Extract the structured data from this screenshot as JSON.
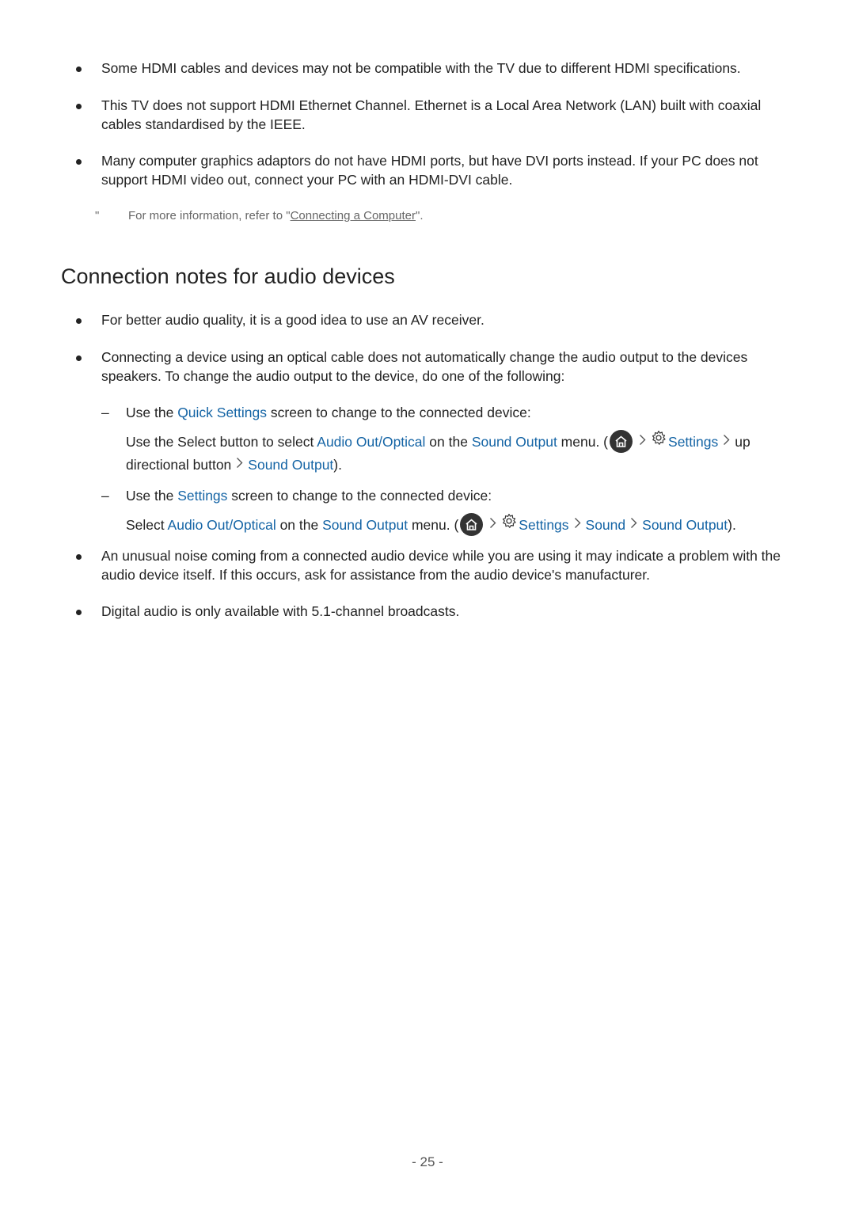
{
  "bullets_top": [
    {
      "text": "Some HDMI cables and devices may not be compatible with the TV due to different HDMI specifications."
    },
    {
      "text": "This TV does not support HDMI Ethernet Channel. Ethernet is a Local Area Network (LAN) built with coaxial cables standardised by the IEEE."
    },
    {
      "text": "Many computer graphics adaptors do not have HDMI ports, but have DVI ports instead. If your PC does not support HDMI video out, connect your PC with an HDMI-DVI cable."
    }
  ],
  "note": {
    "mark": "\"",
    "prefix": "For more information, refer to \"",
    "link": "Connecting a Computer",
    "suffix": "\"."
  },
  "section": {
    "title": "Connection notes for audio devices",
    "bullet1": "For better audio quality, it is a good idea to use an AV receiver.",
    "bullet2": "Connecting a device using an optical cable does not automatically change the audio output to the devices speakers. To change the audio output to the device, do one of the following:",
    "sub1": {
      "dash": "–",
      "pre": "Use the ",
      "link": "Quick Settings",
      "post": " screen to change to the connected device:",
      "para": {
        "t1": "Use the Select button to select ",
        "l1": "Audio Out/Optical",
        "t2": " on the ",
        "l2": "Sound Output",
        "t3": " menu. (",
        "settings": "Settings",
        "t4": "up",
        "t5": "directional button",
        "l3": "Sound Output",
        "t6": ")."
      }
    },
    "sub2": {
      "dash": "–",
      "pre": "Use the ",
      "link": "Settings",
      "post": " screen to change to the connected device:",
      "para": {
        "t1": "Select ",
        "l1": "Audio Out/Optical",
        "t2": " on the ",
        "l2": "Sound Output",
        "t3": " menu. (",
        "settings": "Settings",
        "l3": "Sound",
        "l4": "Sound Output",
        "t4": ")."
      }
    },
    "bullet3": "An unusual noise coming from a connected audio device while you are using it may indicate a problem with the audio device itself. If this occurs, ask for assistance from the audio device's manufacturer.",
    "bullet4": "Digital audio is only available with 5.1-channel broadcasts."
  },
  "footer": {
    "page_number": "- 25 -"
  },
  "colors": {
    "link": "#1464a5",
    "text": "#222222",
    "note": "#666666"
  }
}
